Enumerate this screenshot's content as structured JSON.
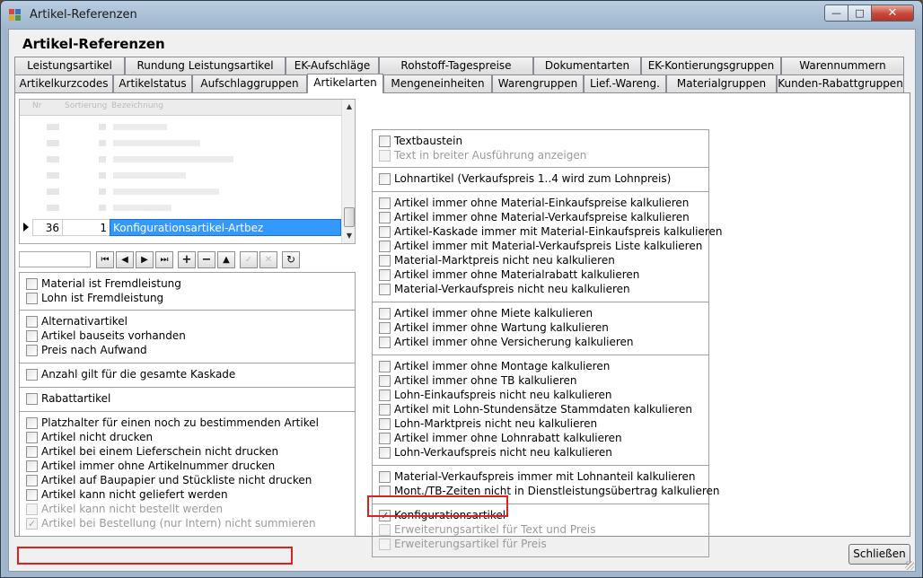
{
  "window": {
    "title": "Artikel-Referenzen",
    "minimize": "—",
    "maximize": "□",
    "close": "✕"
  },
  "page_title": "Artikel-Referenzen",
  "tabs_row1": [
    "Leistungsartikel",
    "Rundung Leistungsartikel",
    "EK-Aufschläge",
    "Rohstoff-Tagespreise",
    "Dokumentarten",
    "EK-Kontierungsgruppen",
    "Warennummern"
  ],
  "tabs_row2": [
    "Artikelkurzcodes",
    "Artikelstatus",
    "Aufschlaggruppen",
    "Artikelarten",
    "Mengeneinheiten",
    "Warengruppen",
    "Lief.-Wareng.",
    "Materialgruppen",
    "Kunden-Rabattgruppen"
  ],
  "active_tab": "Artikelarten",
  "grid": {
    "selected_row": {
      "nr": "36",
      "value": "1",
      "name": "Konfigurationsartikel-Artbez"
    }
  },
  "navigator": {
    "first": "⏮",
    "prev": "◀",
    "next": "▶",
    "last": "⏭",
    "add": "+",
    "delete": "−",
    "up": "▲",
    "edit": "✓",
    "cancel": "✕",
    "refresh": "↻"
  },
  "left_groups": [
    [
      {
        "label": "Material ist Fremdleistung",
        "checked": false,
        "disabled": false
      },
      {
        "label": "Lohn ist Fremdleistung",
        "checked": false,
        "disabled": false
      }
    ],
    [
      {
        "label": "Alternativartikel",
        "checked": false,
        "disabled": false
      },
      {
        "label": "Artikel bauseits vorhanden",
        "checked": false,
        "disabled": false
      },
      {
        "label": "Preis nach Aufwand",
        "checked": false,
        "disabled": false
      }
    ],
    [
      {
        "label": "Anzahl gilt für die gesamte Kaskade",
        "checked": false,
        "disabled": false
      }
    ],
    [
      {
        "label": "Rabattartikel",
        "checked": false,
        "disabled": false
      }
    ],
    [
      {
        "label": "Platzhalter für einen noch zu bestimmenden Artikel",
        "checked": false,
        "disabled": false
      },
      {
        "label": "Artikel nicht drucken",
        "checked": false,
        "disabled": false
      },
      {
        "label": "Artikel bei einem Lieferschein nicht drucken",
        "checked": false,
        "disabled": false
      },
      {
        "label": "Artikel immer ohne Artikelnummer drucken",
        "checked": false,
        "disabled": false
      },
      {
        "label": "Artikel auf Baupapier und Stückliste nicht drucken",
        "checked": false,
        "disabled": false
      },
      {
        "label": "Artikel kann nicht geliefert werden",
        "checked": false,
        "disabled": false
      },
      {
        "label": "Artikel kann nicht bestellt werden",
        "checked": false,
        "disabled": true
      },
      {
        "label": "Artikel bei Bestellung (nur Intern) nicht summieren",
        "checked": true,
        "disabled": true
      }
    ]
  ],
  "right_groups": [
    [
      {
        "label": "Textbaustein",
        "checked": false,
        "disabled": false
      },
      {
        "label": "Text in breiter Ausführung anzeigen",
        "checked": false,
        "disabled": true
      }
    ],
    [
      {
        "label": "Lohnartikel (Verkaufspreis 1..4 wird zum Lohnpreis)",
        "checked": false,
        "disabled": false
      }
    ],
    [
      {
        "label": "Artikel immer ohne Material-Einkaufspreise kalkulieren",
        "checked": false,
        "disabled": false
      },
      {
        "label": "Artikel immer ohne Material-Verkaufspreise kalkulieren",
        "checked": false,
        "disabled": false
      },
      {
        "label": "Artikel-Kaskade immer mit Material-Einkaufspreis kalkulieren",
        "checked": false,
        "disabled": false
      },
      {
        "label": "Artikel immer mit Material-Verkaufspreis Liste kalkulieren",
        "checked": false,
        "disabled": false
      },
      {
        "label": "Material-Marktpreis nicht neu kalkulieren",
        "checked": false,
        "disabled": false
      },
      {
        "label": "Artikel immer ohne Materialrabatt kalkulieren",
        "checked": false,
        "disabled": false
      },
      {
        "label": "Material-Verkaufspreis nicht neu kalkulieren",
        "checked": false,
        "disabled": false
      }
    ],
    [
      {
        "label": "Artikel immer ohne Miete kalkulieren",
        "checked": false,
        "disabled": false
      },
      {
        "label": "Artikel immer ohne Wartung kalkulieren",
        "checked": false,
        "disabled": false
      },
      {
        "label": "Artikel immer ohne Versicherung kalkulieren",
        "checked": false,
        "disabled": false
      }
    ],
    [
      {
        "label": "Artikel immer ohne Montage kalkulieren",
        "checked": false,
        "disabled": false
      },
      {
        "label": "Artikel immer ohne TB kalkulieren",
        "checked": false,
        "disabled": false
      },
      {
        "label": "Lohn-Einkaufspreis nicht neu kalkulieren",
        "checked": false,
        "disabled": false
      },
      {
        "label": "Artikel mit Lohn-Stundensätze Stammdaten kalkulieren",
        "checked": false,
        "disabled": false
      },
      {
        "label": "Lohn-Marktpreis nicht neu kalkulieren",
        "checked": false,
        "disabled": false
      },
      {
        "label": "Artikel immer ohne Lohnrabatt kalkulieren",
        "checked": false,
        "disabled": false
      },
      {
        "label": "Lohn-Verkaufspreis nicht neu kalkulieren",
        "checked": false,
        "disabled": false
      }
    ],
    [
      {
        "label": "Material-Verkaufspreis immer mit Lohnanteil kalkulieren",
        "checked": false,
        "disabled": false
      },
      {
        "label": "Mont./TB-Zeiten nicht in Dienstleistungsübertrag kalkulieren",
        "checked": false,
        "disabled": false
      }
    ],
    [
      {
        "label": "Konfigurationsartikel",
        "checked": true,
        "disabled": false
      },
      {
        "label": "Erweiterungsartikel für Text und Preis",
        "checked": false,
        "disabled": true
      },
      {
        "label": "Erweiterungsartikel für Preis",
        "checked": false,
        "disabled": true
      }
    ]
  ],
  "close_button": "Schließen",
  "colors": {
    "selection": "#3399ff",
    "highlight_border": "#e02020"
  }
}
